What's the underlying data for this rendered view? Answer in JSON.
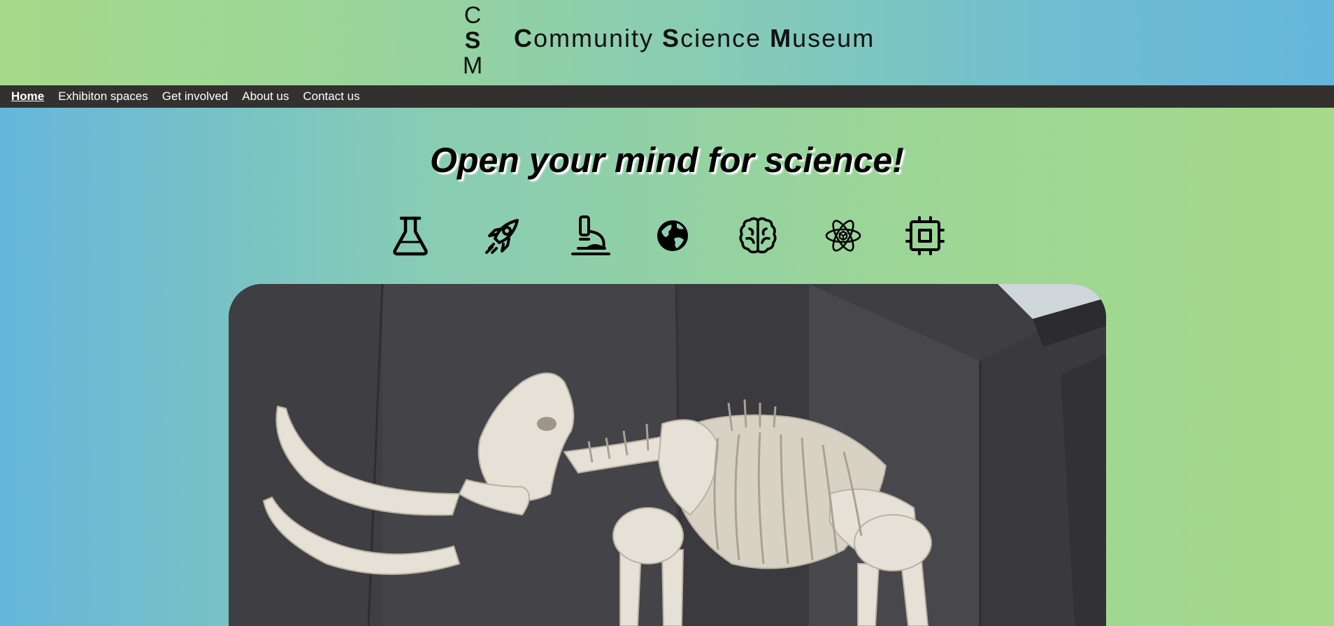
{
  "header": {
    "logo_letters": [
      "C",
      "S",
      "M"
    ],
    "title_parts": [
      {
        "initial": "C",
        "rest": "ommunity "
      },
      {
        "initial": "S",
        "rest": "cience "
      },
      {
        "initial": "M",
        "rest": "useum"
      }
    ]
  },
  "nav": {
    "items": [
      {
        "label": "Home",
        "active": true
      },
      {
        "label": "Exhibiton spaces",
        "active": false
      },
      {
        "label": "Get involved",
        "active": false
      },
      {
        "label": "About us",
        "active": false
      },
      {
        "label": "Contact us",
        "active": false
      }
    ]
  },
  "hero": {
    "title": "Open your mind for science!",
    "icons": [
      "flask-icon",
      "rocket-icon",
      "microscope-icon",
      "globe-icon",
      "brain-icon",
      "atom-icon",
      "chip-icon"
    ]
  },
  "photo": {
    "subject": "mammoth-skeleton"
  }
}
